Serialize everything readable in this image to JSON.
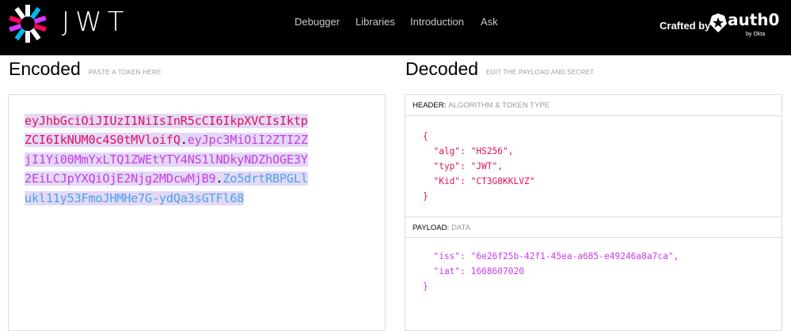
{
  "brand": {
    "wordmark": "JWT",
    "crafted_by": "Crafted by",
    "partner_name": "auth0",
    "partner_sub": "by Okta"
  },
  "nav": {
    "items": [
      "Debugger",
      "Libraries",
      "Introduction",
      "Ask"
    ]
  },
  "encoded": {
    "title": "Encoded",
    "subtitle": "PASTE A TOKEN HERE",
    "token_header": "eyJhbGciOiJIUzI1NiIsInR5cCI6IkpXVCIsIktpZCI6IkNUM0c4S0tMVloifQ",
    "token_payload": "eyJpc3MiOiI2ZTI2ZjI1Yi00MmYxLTQ1ZWEtYTY4NS1lNDkyNDZhOGE3Y2EiLCJpYXQiOjE2Njg2MDcwMjB9",
    "token_signature": "Zo5drtRBPGLlukl11y53FmoJHMHe7G-ydQa3sGTFl68",
    "dot": "."
  },
  "decoded": {
    "title": "Decoded",
    "subtitle": "EDIT THE PAYLOAD AND SECRET",
    "header_label": "HEADER:",
    "header_desc": "ALGORITHM & TOKEN TYPE",
    "header_json": "{\n  \"alg\": \"HS256\",\n  \"typ\": \"JWT\",\n  \"Kid\": \"CT3G8KKLVZ\"\n}",
    "payload_label": "PAYLOAD:",
    "payload_desc": "DATA",
    "payload_json": "  \"iss\": \"6e26f25b-42f1-45ea-a685-e49246a8a7ca\",\n  \"iat\": 1668607020\n}"
  },
  "colors": {
    "header": "#e0115f",
    "payload": "#c63de6",
    "signature": "#4aa3e8",
    "selection": "#e3d9f6"
  }
}
